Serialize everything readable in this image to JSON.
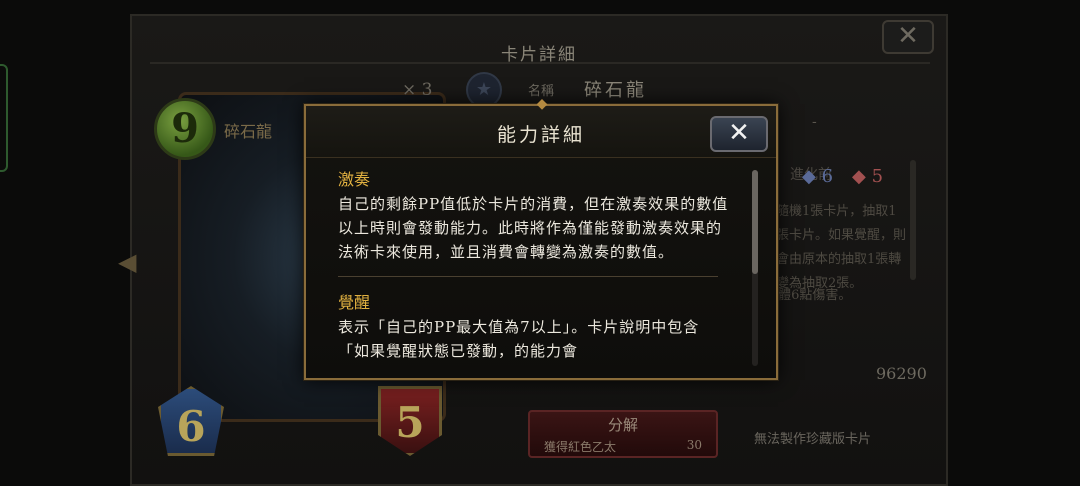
{
  "background": {
    "title": "卡片詳細",
    "close_label": "✕",
    "count": "× 3",
    "name_label": "名稱",
    "name_value": "碎石龍",
    "dash": "-",
    "evolve_label": "進化前",
    "stat_blue": "6",
    "stat_red": "5",
    "desc_fragment": "隨機1張卡片，抽取1張卡片。如果覺醒，則會由原本的抽取1張轉變為抽取2張。",
    "desc_fragment2": "入場曲 給予敵方的主戰者與敵方的從者全體6點傷害。",
    "number": "96290",
    "dismantle_label": "分解",
    "dismantle_sub": "獲得紅色乙太",
    "dismantle_num": "30",
    "no_craft": "無法製作珍藏版卡片"
  },
  "card": {
    "name": "碎石龍",
    "cost": "9",
    "attack": "6",
    "defense": "5"
  },
  "modal": {
    "title": "能力詳細",
    "close_label": "✕",
    "keywords": [
      {
        "title": "激奏",
        "text": "自己的剩餘PP值低於卡片的消費，但在激奏效果的數值以上時則會發動能力。此時將作為僅能發動激奏效果的法術卡來使用，並且消費會轉變為激奏的數值。"
      },
      {
        "title": "覺醒",
        "text": "表示「自己的PP最大值為7以上」。卡片說明中包含「如果覺醒狀態已發動，的能力會"
      }
    ]
  }
}
